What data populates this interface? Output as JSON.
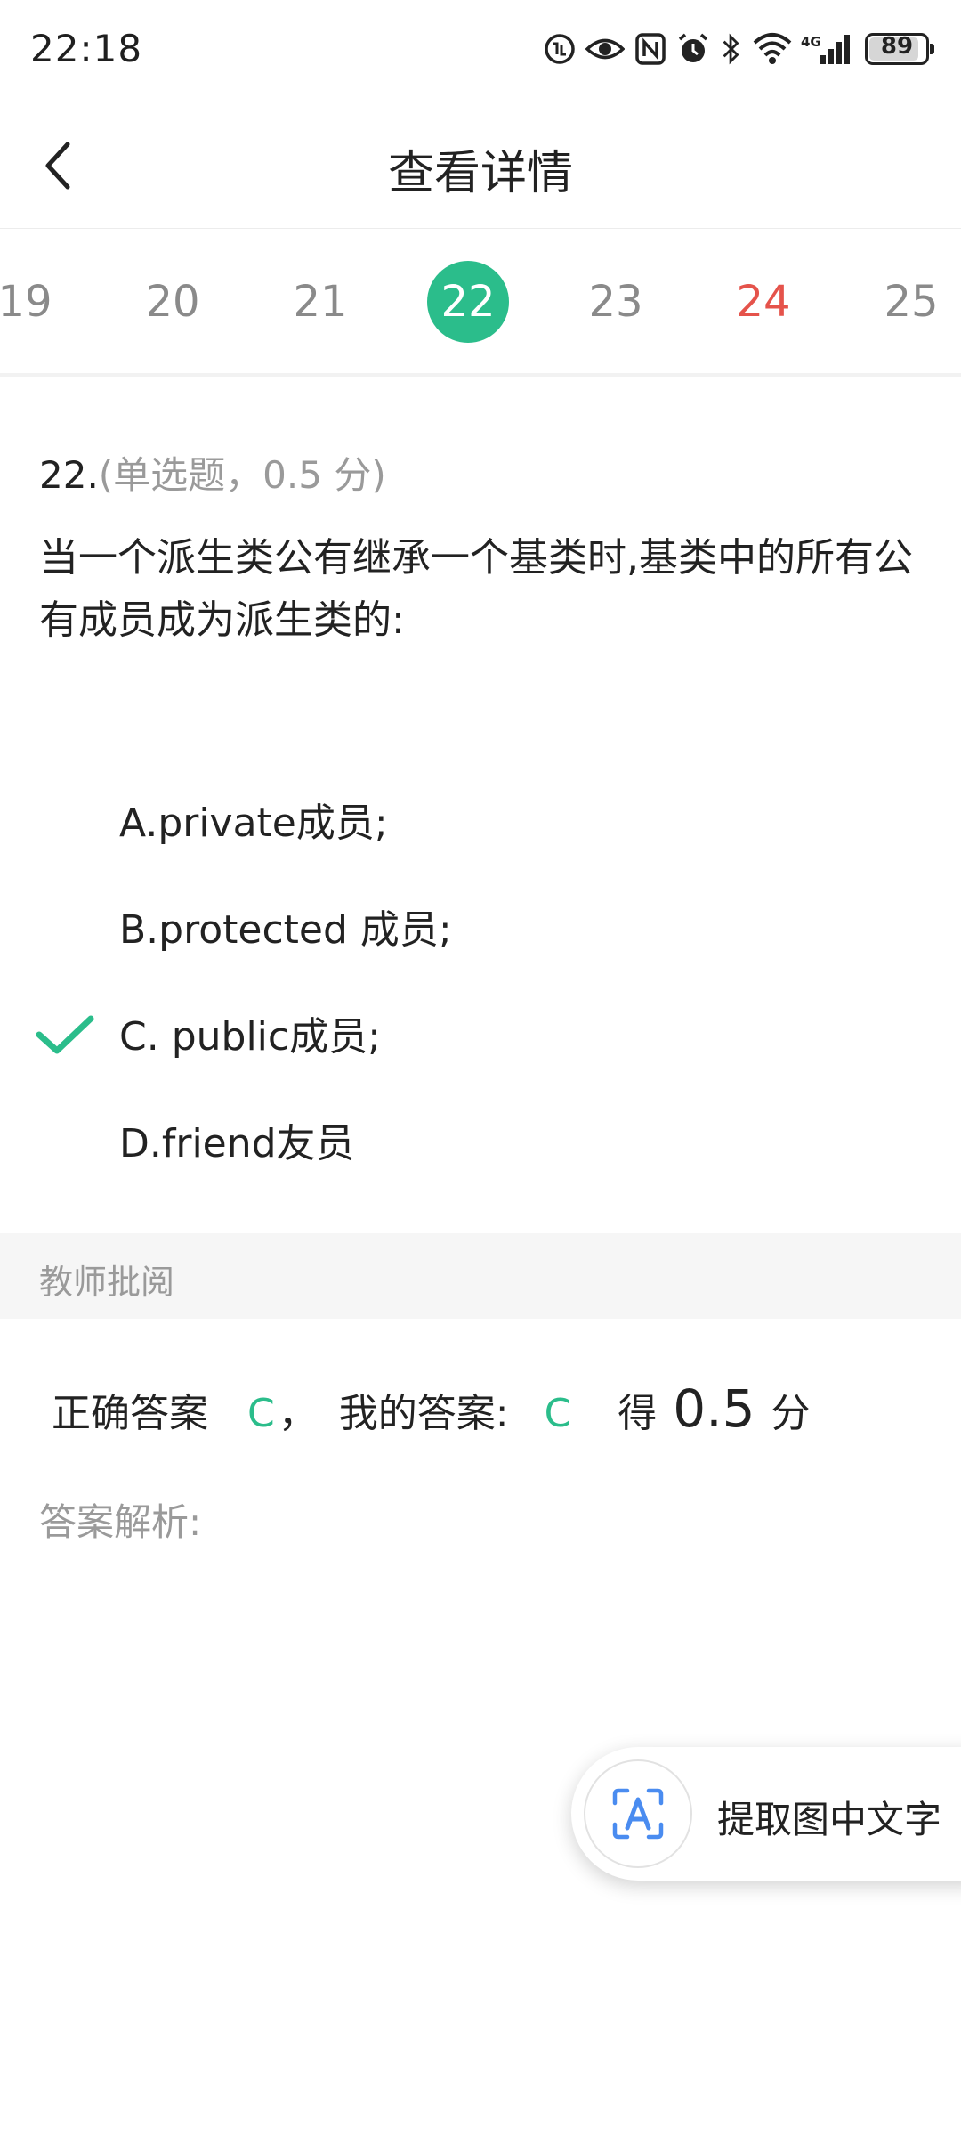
{
  "status_bar": {
    "time": "22:18",
    "icons": [
      "hd-call-icon",
      "eye-icon",
      "nfc-icon",
      "alarm-icon",
      "bluetooth-icon",
      "wifi-icon",
      "signal-4g-icon"
    ],
    "battery_text": "89",
    "battery_level": 0.89
  },
  "header": {
    "title": "查看详情",
    "back_icon": "chevron-left-icon"
  },
  "question_numbers": [
    {
      "label": "19",
      "state": "normal"
    },
    {
      "label": "20",
      "state": "normal"
    },
    {
      "label": "21",
      "state": "normal"
    },
    {
      "label": "22",
      "state": "active"
    },
    {
      "label": "23",
      "state": "normal"
    },
    {
      "label": "24",
      "state": "flagged"
    },
    {
      "label": "25",
      "state": "normal"
    }
  ],
  "question": {
    "number": "22.",
    "meta": "(单选题，0.5 分)",
    "text": "当一个派生类公有继承一个基类时,基类中的所有公有成员成为派生类的:",
    "options": [
      {
        "label": "A.private成员;",
        "selected": false
      },
      {
        "label": "B.protected 成员;",
        "selected": false
      },
      {
        "label": "C. public成员;",
        "selected": true
      },
      {
        "label": "D.friend友员",
        "selected": false
      }
    ]
  },
  "review": {
    "section_label": "教师批阅",
    "correct_label": "正确答案",
    "correct_value": "C",
    "separator": "，",
    "my_label": "我的答案:",
    "my_value": "C",
    "score_prefix": "得",
    "score_value": "0.5",
    "score_suffix": "分",
    "analysis_label": "答案解析:"
  },
  "ocr_button": {
    "label": "提取图中文字",
    "icon": "text-scan-icon"
  },
  "colors": {
    "accent": "#2bbd8b",
    "flagged": "#e5534b",
    "muted": "#9a9a9a"
  }
}
